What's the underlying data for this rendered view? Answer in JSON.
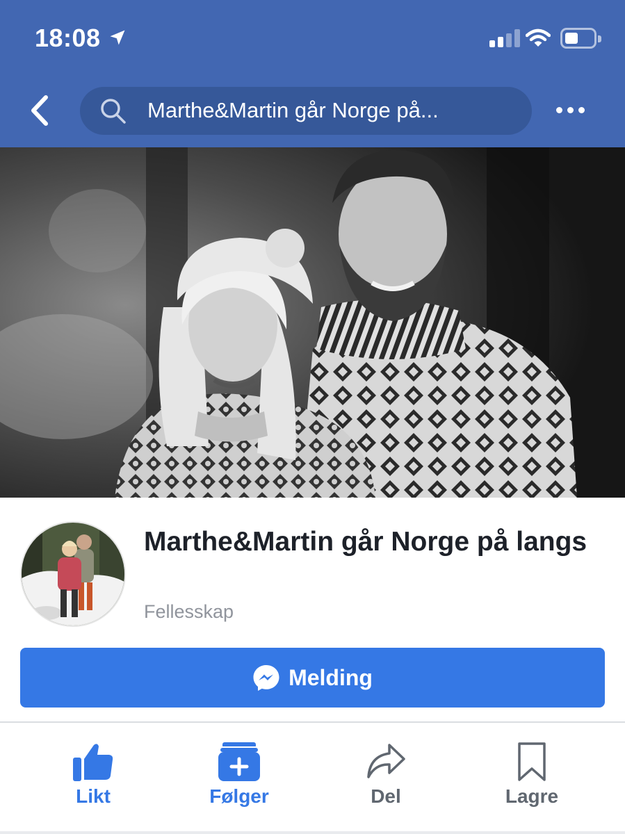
{
  "status_bar": {
    "time": "18:08",
    "icons": [
      "location-arrow-icon",
      "cellular-signal-icon",
      "wifi-icon",
      "battery-icon"
    ]
  },
  "nav": {
    "back_icon": "chevron-left-icon",
    "search_icon": "search-icon",
    "search_text": "Marthe&Martin går Norge på...",
    "more_icon": "more-horizontal-icon"
  },
  "page": {
    "name": "Marthe&Martin går Norge på langs",
    "category": "Fellesskap"
  },
  "message_button": {
    "label": "Melding",
    "icon": "messenger-icon"
  },
  "actions": [
    {
      "label": "Likt",
      "icon": "thumbs-up-icon",
      "active": true
    },
    {
      "label": "Følger",
      "icon": "follow-stack-icon",
      "active": true
    },
    {
      "label": "Del",
      "icon": "share-arrow-icon",
      "active": false
    },
    {
      "label": "Lagre",
      "icon": "bookmark-icon",
      "active": false
    }
  ],
  "colors": {
    "header_bg": "#4267b2",
    "search_bg": "#365899",
    "primary_blue": "#3578e5",
    "title_text": "#1d2129",
    "secondary_text": "#90949c",
    "inactive_action": "#606770"
  }
}
